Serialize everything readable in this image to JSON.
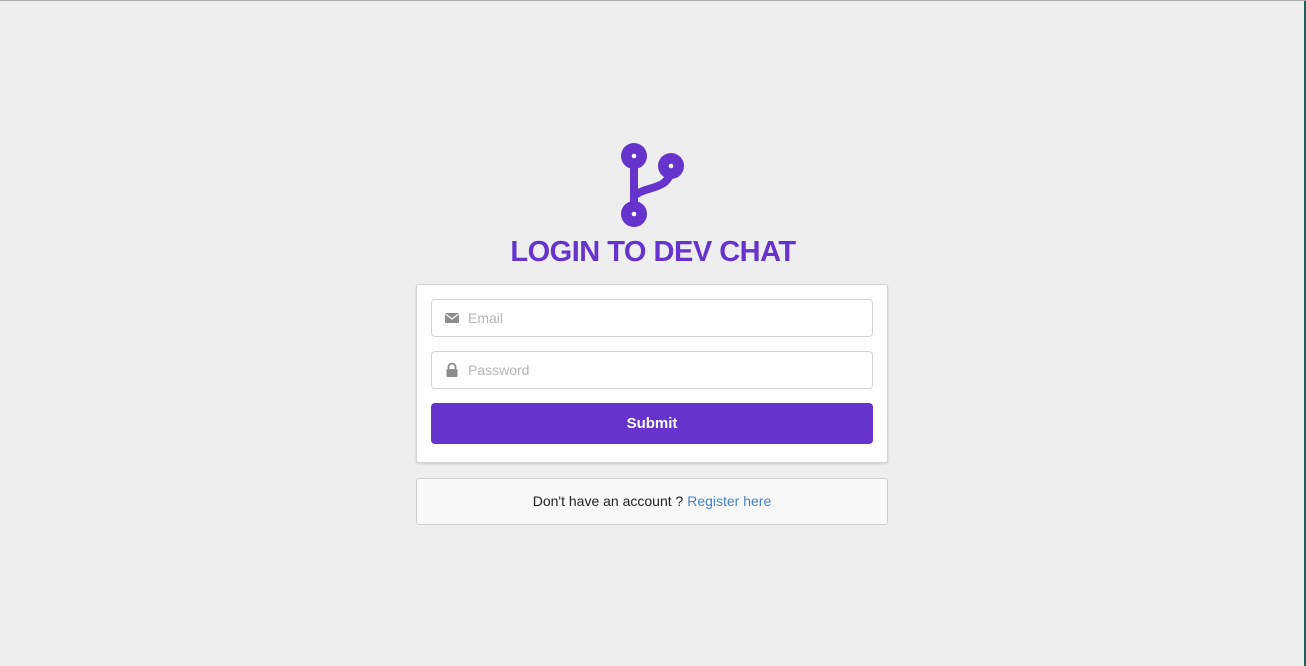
{
  "brand": {
    "title": "LOGIN TO DEV CHAT",
    "logo_icon": "code-branch-icon",
    "accent_color": "#6633cc"
  },
  "form": {
    "email": {
      "icon": "envelope-icon",
      "placeholder": "Email",
      "value": ""
    },
    "password": {
      "icon": "lock-icon",
      "placeholder": "Password",
      "value": ""
    },
    "submit_label": "Submit"
  },
  "register": {
    "prompt": "Don't have an account ?",
    "link_label": "Register here",
    "link_color": "#4183c4"
  }
}
